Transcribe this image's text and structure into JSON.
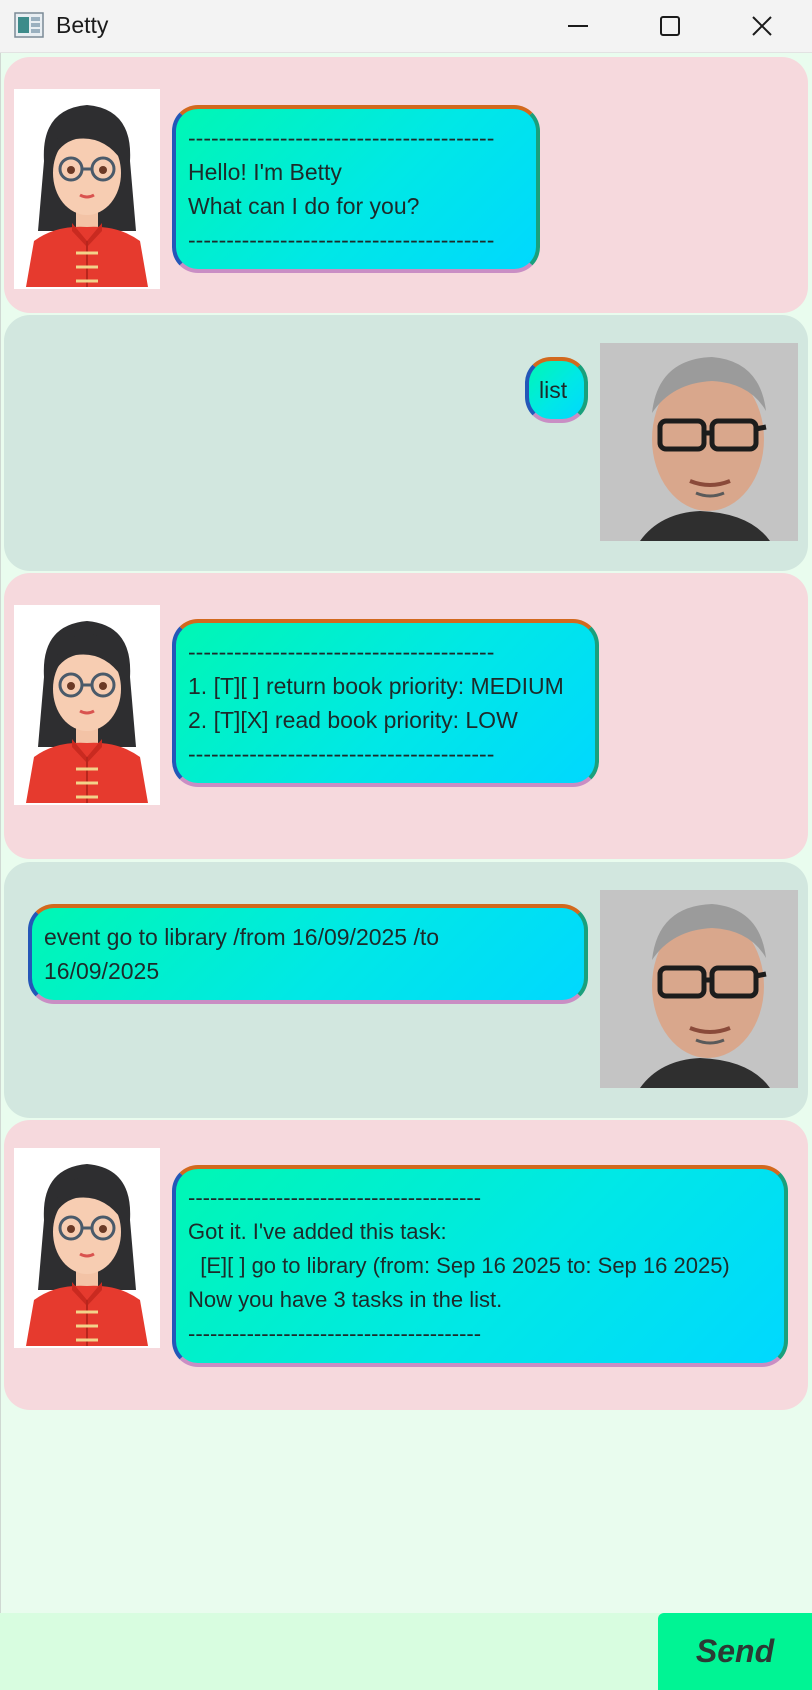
{
  "window": {
    "title": "Betty"
  },
  "messages": [
    {
      "sender": "bot",
      "lines": [
        "----------------------------------------",
        "Hello! I'm Betty",
        "What can I do for you?",
        "----------------------------------------"
      ]
    },
    {
      "sender": "user",
      "lines": [
        "list"
      ]
    },
    {
      "sender": "bot",
      "lines": [
        "----------------------------------------",
        "1. [T][ ] return book priority: MEDIUM",
        "2. [T][X] read book priority: LOW",
        "",
        "----------------------------------------"
      ]
    },
    {
      "sender": "user",
      "lines": [
        "event go to library /from 16/09/2025 /to",
        "16/09/2025"
      ]
    },
    {
      "sender": "bot",
      "lines": [
        "----------------------------------------",
        "Got it. I've added this task:",
        "  [E][ ] go to library (from: Sep 16 2025 to: Sep 16 2025)",
        "Now you have 3 tasks in the list.",
        "----------------------------------------"
      ]
    }
  ],
  "input": {
    "value": "",
    "placeholder": ""
  },
  "send": {
    "label": "Send"
  },
  "colors": {
    "bot_row": "#f6d9dd",
    "user_row": "#d2e7df",
    "chat_bg": "#e9fcee",
    "send_button": "#00f494",
    "bubble_gradient_start": "#00f7b4",
    "bubble_gradient_end": "#00d8ff"
  }
}
